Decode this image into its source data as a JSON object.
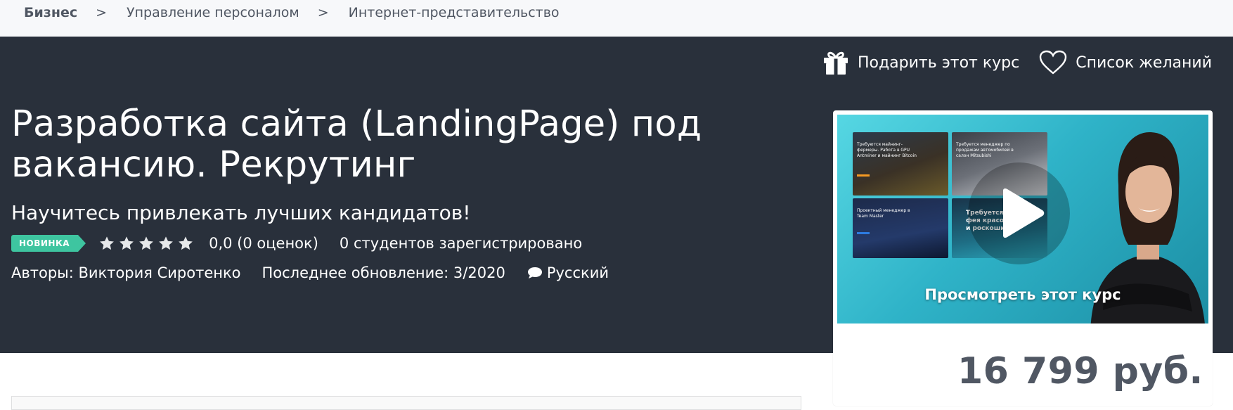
{
  "breadcrumb": {
    "items": [
      "Бизнес",
      "Управление персоналом",
      "Интернет-представительство"
    ],
    "separator": ">"
  },
  "actions": {
    "gift_label": "Подарить этот курс",
    "wishlist_label": "Список желаний"
  },
  "course": {
    "title": "Разработка сайта (LandingPage) под вакансию. Рекрутинг",
    "subtitle": "Научитесь привлекать лучших кандидатов!",
    "badge": "НОВИНКА",
    "rating_stars": 0,
    "rating_text": "0,0 (0 оценок)",
    "students": "0 студентов зарегистрировано",
    "authors": "Авторы: Виктория Сиротенко",
    "updated": "Последнее обновление: 3/2020",
    "language": "Русский"
  },
  "preview": {
    "label": "Просмотреть этот курс",
    "thumb_texts": [
      "Требуются майнинг-фермеры. Работа в GPU Antminer и майнинг Bitcoin",
      "Требуется менеджер по продажам автомобилей в салон Mitsubishi",
      "Проектный менеджер в Team Master",
      "Требуется фея красоты и роскоши"
    ]
  },
  "pricing": {
    "price": "16 799 руб."
  },
  "colors": {
    "hero_bg": "#29303b",
    "badge_bg": "#3ec5a0",
    "breadcrumb_bg": "#f7f8fa",
    "price_text": "#505763"
  }
}
